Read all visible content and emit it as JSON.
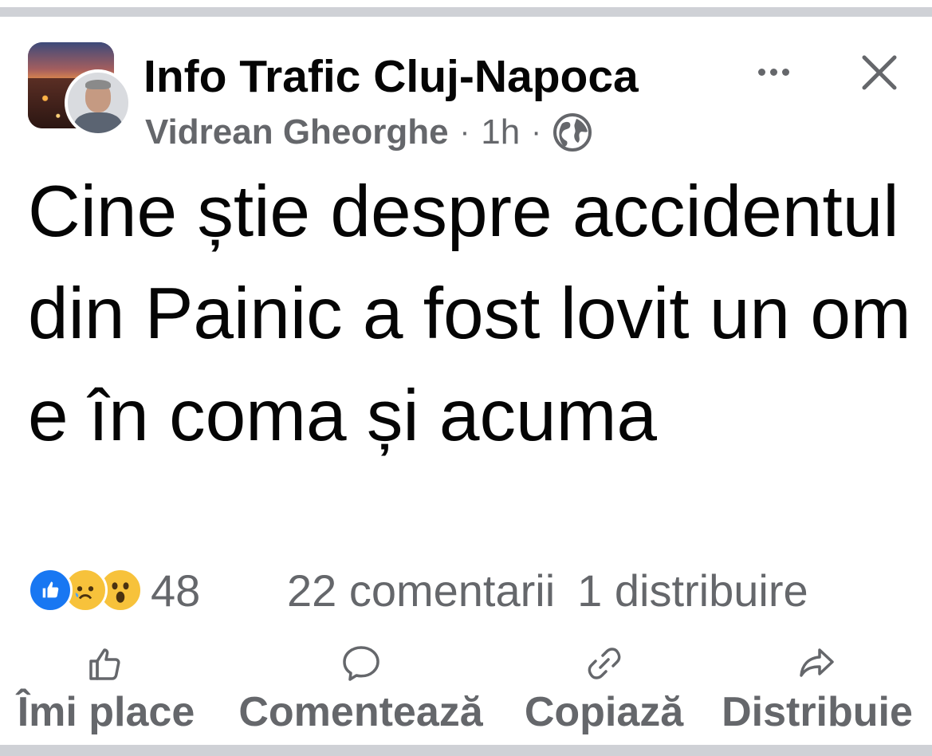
{
  "post": {
    "group_name": "Info Trafic Cluj-Napoca",
    "author": "Vidrean Gheorghe",
    "time": "1h",
    "separator": "·",
    "audience_icon": "globe-icon",
    "text": "Cine știe despre accidentul din Painic a fost lovit un om e în coma și acuma",
    "more_icon": "more-dots-icon",
    "close_icon": "close-icon"
  },
  "engagement": {
    "reactions": [
      "like-reaction-icon",
      "sad-reaction-icon",
      "wow-reaction-icon"
    ],
    "reaction_count": "48",
    "comments": "22 comentarii",
    "shares": "1 distribuire"
  },
  "actions": [
    {
      "label": "Îmi place",
      "icon": "thumbs-up-icon"
    },
    {
      "label": "Comentează",
      "icon": "comment-bubble-icon"
    },
    {
      "label": "Copiază",
      "icon": "link-icon"
    },
    {
      "label": "Distribuie",
      "icon": "share-arrow-icon"
    }
  ],
  "colors": {
    "primary_text": "#050505",
    "secondary_text": "#65676b",
    "like_blue": "#1877f2",
    "reaction_yellow": "#f7c23b",
    "divider": "#cfd1d6"
  }
}
